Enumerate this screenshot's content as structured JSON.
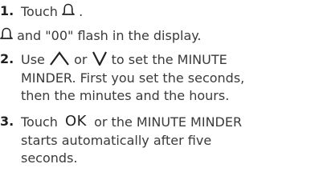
{
  "steps": [
    {
      "number": "1.",
      "before_icon": "Touch ",
      "icon": "bell-icon",
      "after_icon": "."
    },
    {
      "note_icon": "bell-icon",
      "note_text": " and \"00\" flash in the display."
    },
    {
      "number": "2.",
      "line1_a": "Use ",
      "up_icon": "up-chevron-icon",
      "line1_b": " or ",
      "down_icon": "down-chevron-icon",
      "line1_c": " to set the MINUTE",
      "line2": "MINDER. First you set the seconds,",
      "line3": "then the minutes and the hours."
    },
    {
      "number": "3.",
      "line1_a": "Touch ",
      "ok_label": "OK",
      "line1_b": " or the MINUTE MINDER",
      "line2": "starts automatically after five",
      "line3": "seconds."
    }
  ],
  "colors": {
    "text": "#3a3a3a",
    "number": "#1f1f1f",
    "icon": "#222222"
  }
}
